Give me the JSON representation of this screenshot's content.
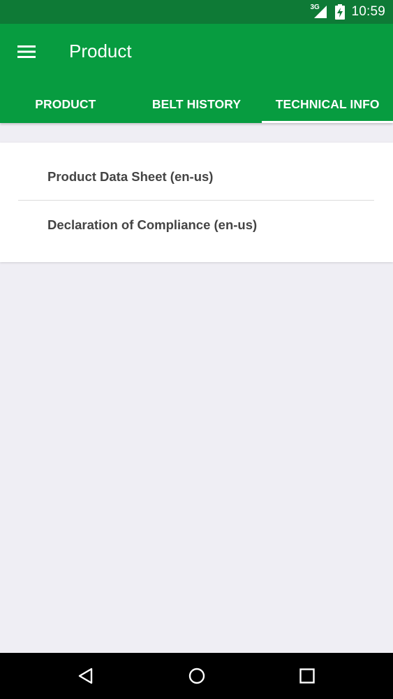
{
  "status_bar": {
    "network_label": "3G",
    "time": "10:59",
    "icons": [
      "signal-icon",
      "battery-charging-icon"
    ]
  },
  "app_bar": {
    "title": "Product",
    "menu_icon": "menu-icon"
  },
  "tabs": [
    {
      "label": "PRODUCT",
      "selected": false
    },
    {
      "label": "BELT HISTORY",
      "selected": false
    },
    {
      "label": "TECHNICAL INFO",
      "selected": true
    }
  ],
  "documents": [
    {
      "label": "Product Data Sheet (en-us)"
    },
    {
      "label": "Declaration of Compliance (en-us)"
    }
  ],
  "nav_bar": {
    "icons": [
      "back-icon",
      "home-icon",
      "recents-icon"
    ]
  },
  "colors": {
    "status_bar": "#0e7a36",
    "app_bar": "#079c40",
    "background": "#efeef4",
    "card": "#ffffff",
    "item_text": "#444444",
    "nav_bar": "#000000"
  }
}
